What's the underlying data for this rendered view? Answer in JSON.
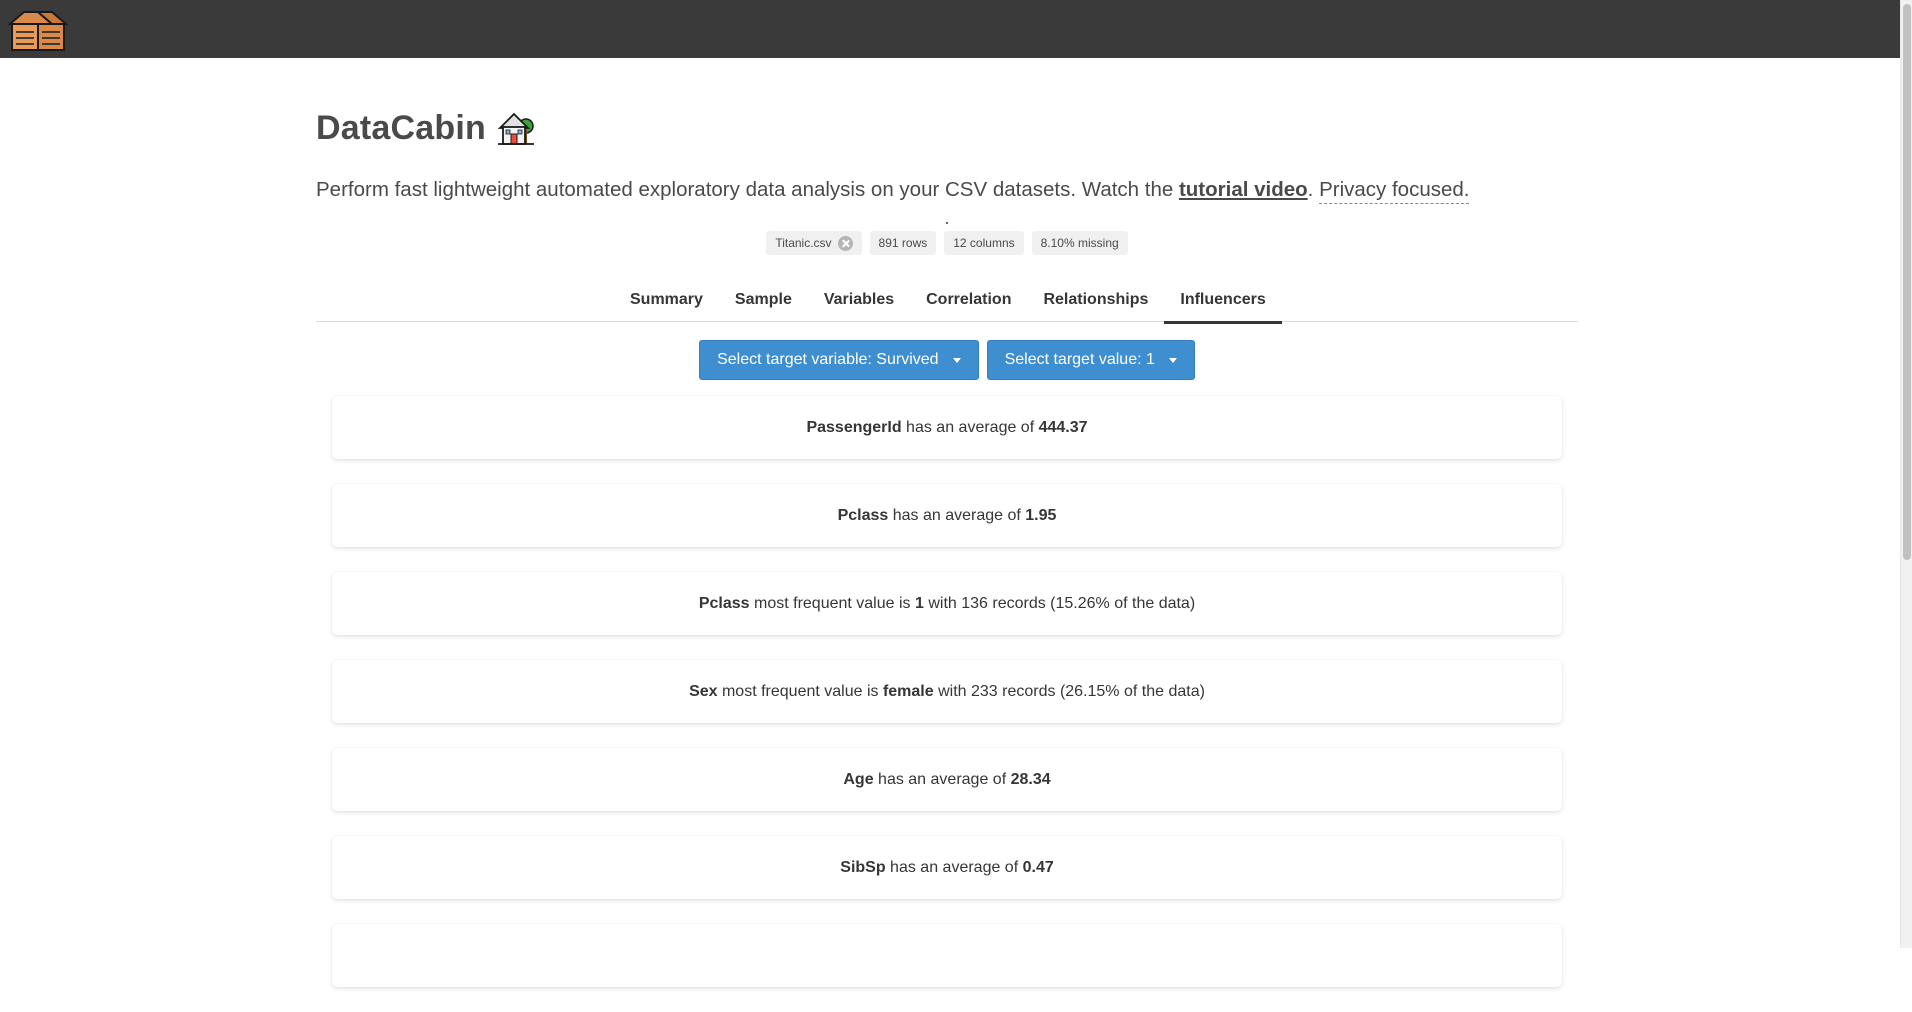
{
  "app": {
    "title": "DataCabin",
    "subtitle_prefix": "Perform fast lightweight automated exploratory data analysis on your CSV datasets. Watch the ",
    "subtitle_link": "tutorial video",
    "subtitle_period": ". ",
    "subtitle_privacy": "Privacy focused."
  },
  "dataset": {
    "file": "Titanic.csv",
    "rows": "891 rows",
    "columns": "12 columns",
    "missing": "8.10% missing"
  },
  "tabs": [
    {
      "label": "Summary"
    },
    {
      "label": "Sample"
    },
    {
      "label": "Variables"
    },
    {
      "label": "Correlation"
    },
    {
      "label": "Relationships"
    },
    {
      "label": "Influencers"
    }
  ],
  "active_tab": "Influencers",
  "controls": {
    "target_variable": "Select target variable: Survived",
    "target_value": "Select target value: 1"
  },
  "influencers": [
    {
      "v1": "PassengerId",
      "t1": " has an average of ",
      "v2": "444.37",
      "t2": ""
    },
    {
      "v1": "Pclass",
      "t1": " has an average of ",
      "v2": "1.95",
      "t2": ""
    },
    {
      "v1": "Pclass",
      "t1": " most frequent value is ",
      "v2": "1",
      "t2": " with 136 records (15.26% of the data)"
    },
    {
      "v1": "Sex",
      "t1": " most frequent value is ",
      "v2": "female",
      "t2": " with 233 records (26.15% of the data)"
    },
    {
      "v1": "Age",
      "t1": " has an average of ",
      "v2": "28.34",
      "t2": ""
    },
    {
      "v1": "SibSp",
      "t1": " has an average of ",
      "v2": "0.47",
      "t2": ""
    }
  ],
  "colors": {
    "topbar": "#3a3a3a",
    "button": "#3e8ed0",
    "text": "#363636"
  },
  "icons": {
    "logo": "cabin-logo-icon",
    "title": "house-emoji-icon",
    "tag_delete": "close-circle-icon",
    "dropdown": "caret-down-icon"
  }
}
